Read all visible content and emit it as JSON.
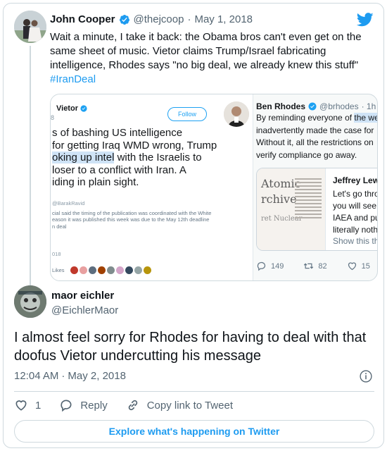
{
  "colors": {
    "accent": "#1d9bf0",
    "text": "#0f1419",
    "muted": "#536471",
    "border": "#cfd9de"
  },
  "quoted_tweet": {
    "author_name": "John Cooper",
    "author_handle": "@thejcoop",
    "separator": "·",
    "date": "May 1, 2018",
    "text": "Wait a minute, I take it back: the Obama bros can't even get on the same sheet of music. Vietor claims Trump/Israel fabricating intelligence, Rhodes says \"no big deal, we already knew this stuff\"",
    "hashtag": "#IranDeal",
    "icons": {
      "verified": "verified-badge-icon",
      "brand": "twitter-bird-icon"
    }
  },
  "embedded_image": {
    "left": {
      "name": "Vietor",
      "follow_label": "Follow",
      "small_number": "8",
      "body_lines": [
        "s of bashing US intelligence",
        "for getting Iraq WMD wrong, Trump",
        "oking up intel",
        " with the Israelis to",
        "loser to a conflict with Iran. A",
        "iding in plain sight."
      ],
      "tag": "@BarakRavid",
      "meta_lines": [
        "cial said the timing of the publication was coordinated with the White",
        "eason it was published this week was due to the May 12th deadline",
        "n deal"
      ],
      "count": "018",
      "likes_label": "Likes"
    },
    "right": {
      "author_name": "Ben Rhodes",
      "author_handle": "@brhodes",
      "time": "· 1h",
      "text_lines": [
        "By reminding everyone of ",
        "the we",
        "inadvertently made the case for",
        "Without it, all the restrictions on",
        "verify compliance go away."
      ],
      "nested": {
        "image_words": [
          "Atomic",
          "rchive",
          "ret Nuclear"
        ],
        "author_name": "Jeffrey Lew",
        "text_lines": [
          "Let's go thro",
          "you will see,",
          "IAEA and pu",
          "literally noth"
        ],
        "show_thread": "Show this th"
      },
      "replies": "149",
      "retweets": "82",
      "likes": "15"
    }
  },
  "main_tweet": {
    "author_name": "maor eichler",
    "author_handle": "@EichlerMaor",
    "text": "I almost feel sorry for Rhodes for having to deal with that doofus Vietor undercutting his message",
    "time": "12:04 AM",
    "separator": "·",
    "date": "May 2, 2018",
    "like_count": "1",
    "reply_label": "Reply",
    "copy_link_label": "Copy link to Tweet",
    "explore_label": "Explore what's happening on Twitter"
  }
}
